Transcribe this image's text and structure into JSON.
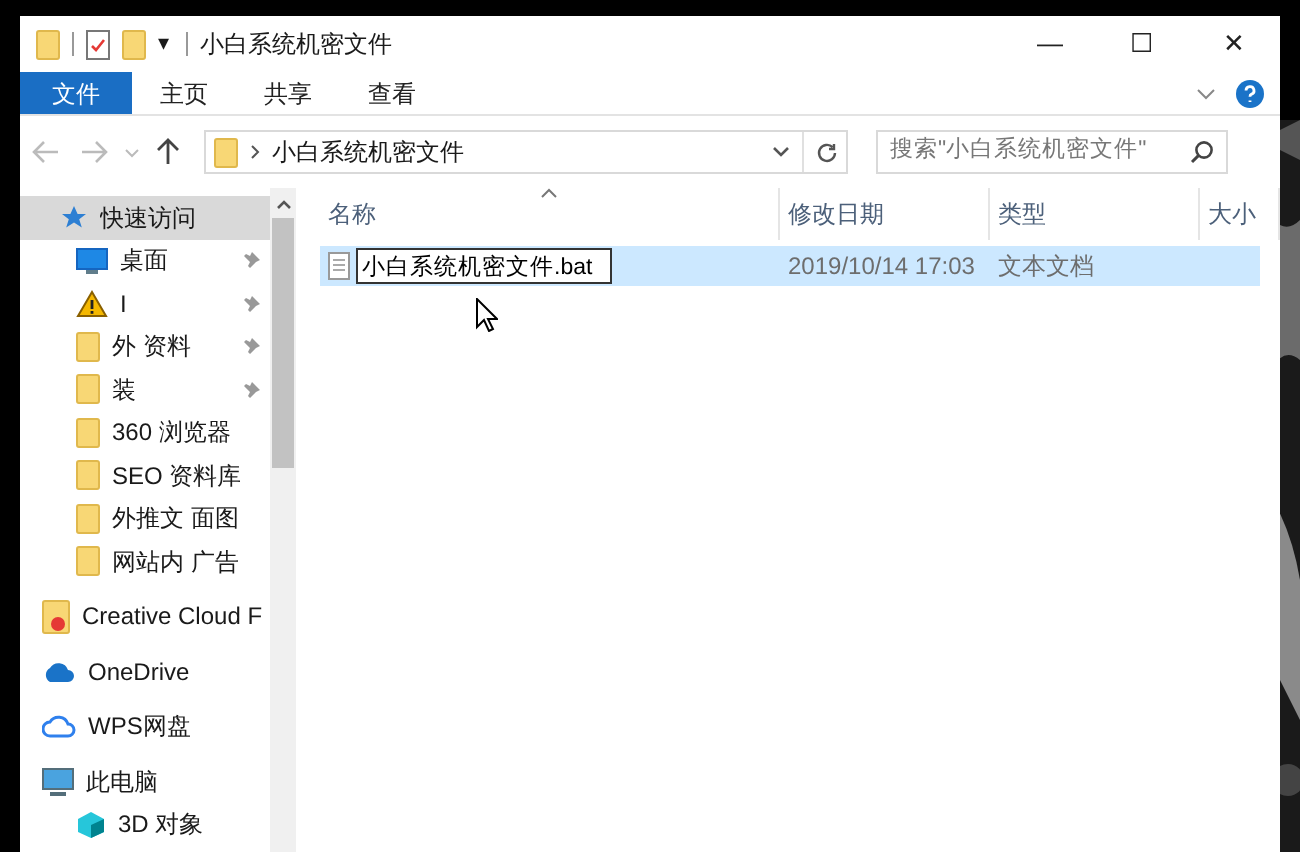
{
  "window": {
    "title": "小白系统机密文件",
    "quick_access_toolbar": [
      "▾"
    ],
    "controls": [
      "—",
      "☐",
      "✕"
    ]
  },
  "ribbon": {
    "tabs": [
      {
        "label": "文件",
        "selected": true
      },
      {
        "label": "主页",
        "selected": false
      },
      {
        "label": "共享",
        "selected": false
      },
      {
        "label": "查看",
        "selected": false
      }
    ]
  },
  "address_bar": {
    "path": "小白系统机密文件",
    "search_placeholder": "搜索\"小白系统机密文件\""
  },
  "sidebar": {
    "items": [
      {
        "label": "快速访问",
        "kind": "star",
        "selected": true,
        "children": [
          {
            "label": "桌面",
            "kind": "desktop",
            "pinned": true,
            "selected": false
          },
          {
            "label": "I",
            "kind": "warning",
            "pinned": true,
            "selected": false
          },
          {
            "label": "外   资料",
            "kind": "folder",
            "pinned": true,
            "selected": false
          },
          {
            "label": "装",
            "kind": "folder",
            "pinned": true,
            "selected": false
          },
          {
            "label": "360   浏览器",
            "kind": "folder",
            "pinned": false,
            "selected": false
          },
          {
            "label": "SEO  资料库",
            "kind": "folder",
            "pinned": false,
            "selected": false
          },
          {
            "label": "外推文  面图",
            "kind": "folder",
            "pinned": false,
            "selected": false
          },
          {
            "label": "网站内  广告",
            "kind": "folder",
            "pinned": false,
            "selected": false
          }
        ]
      },
      {
        "label": "Creative Cloud F",
        "kind": "cc",
        "selected": false
      },
      {
        "label": "OneDrive",
        "kind": "cloud",
        "selected": false
      },
      {
        "label": "WPS网盘",
        "kind": "cloud-outline",
        "selected": false
      },
      {
        "label": "此电脑",
        "kind": "pc",
        "selected": false,
        "children": [
          {
            "label": "3D 对象",
            "kind": "cube",
            "selected": false
          }
        ]
      }
    ]
  },
  "table": {
    "columns": [
      "名称",
      "修改日期",
      "类型",
      "大小"
    ],
    "rows": [
      {
        "name": "小白系统机密文件.bat",
        "modified": "2019/10/14 17:03",
        "type": "文本文档",
        "selected": true,
        "renaming": true
      }
    ]
  }
}
